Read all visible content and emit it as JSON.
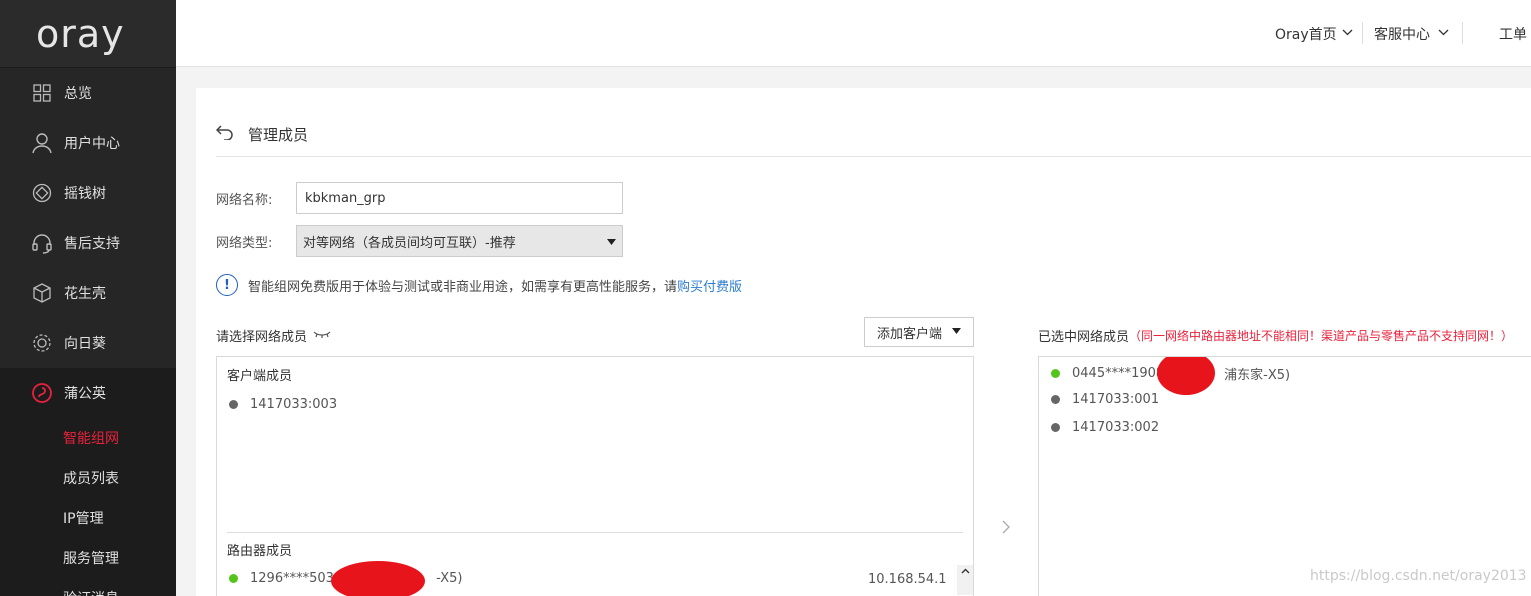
{
  "logo": "oray",
  "sidebar": {
    "items": [
      {
        "label": "总览",
        "icon": "grid-icon"
      },
      {
        "label": "用户中心",
        "icon": "user-icon"
      },
      {
        "label": "摇钱树",
        "icon": "money-tree-icon"
      },
      {
        "label": "售后支持",
        "icon": "headset-icon"
      },
      {
        "label": "花生壳",
        "icon": "cube-icon"
      },
      {
        "label": "向日葵",
        "icon": "sunflower-icon"
      },
      {
        "label": "蒲公英",
        "icon": "dandelion-icon"
      }
    ],
    "sub_items": [
      "智能组网",
      "成员列表",
      "IP管理",
      "服务管理",
      "验证消息"
    ]
  },
  "topbar": {
    "oray_home": "Oray首页",
    "service_center": "客服中心",
    "tickets": "工单"
  },
  "page": {
    "title": "管理成员",
    "network_name_label": "网络名称:",
    "network_name_value": "kbkman_grp",
    "network_type_label": "网络类型:",
    "network_type_value": "对等网络（各成员间均可互联）-推荐",
    "notice_text": "智能组网免费版用于体验与测试或非商业用途，如需享有更高性能服务，请",
    "notice_link": "购买付费版"
  },
  "left_panel": {
    "title": "请选择网络成员",
    "add_button": "添加客户端",
    "client_group": "客户端成员",
    "client_members": [
      "1417033:003"
    ],
    "router_group": "路由器成员",
    "router_members": [
      {
        "name_prefix": "1296****5030",
        "name_suffix": "-X5)",
        "ip": "10.168.54.1",
        "online": true
      }
    ]
  },
  "right_panel": {
    "title": "已选中网络成员",
    "warning": "（同一网络中路由器地址不能相同！渠道产品与零售产品不支持同网！）",
    "members": [
      {
        "name_prefix": "0445****1908",
        "name_suffix": "浦东家-X5)",
        "online": true
      },
      {
        "name": "1417033:001",
        "online": false
      },
      {
        "name": "1417033:002",
        "online": false
      }
    ]
  },
  "watermark": "https://blog.csdn.net/oray2013",
  "colors": {
    "accent_red": "#e8223c",
    "online_green": "#52c41a",
    "link_blue": "#2d7ccc",
    "sidebar_bg": "#262626"
  }
}
